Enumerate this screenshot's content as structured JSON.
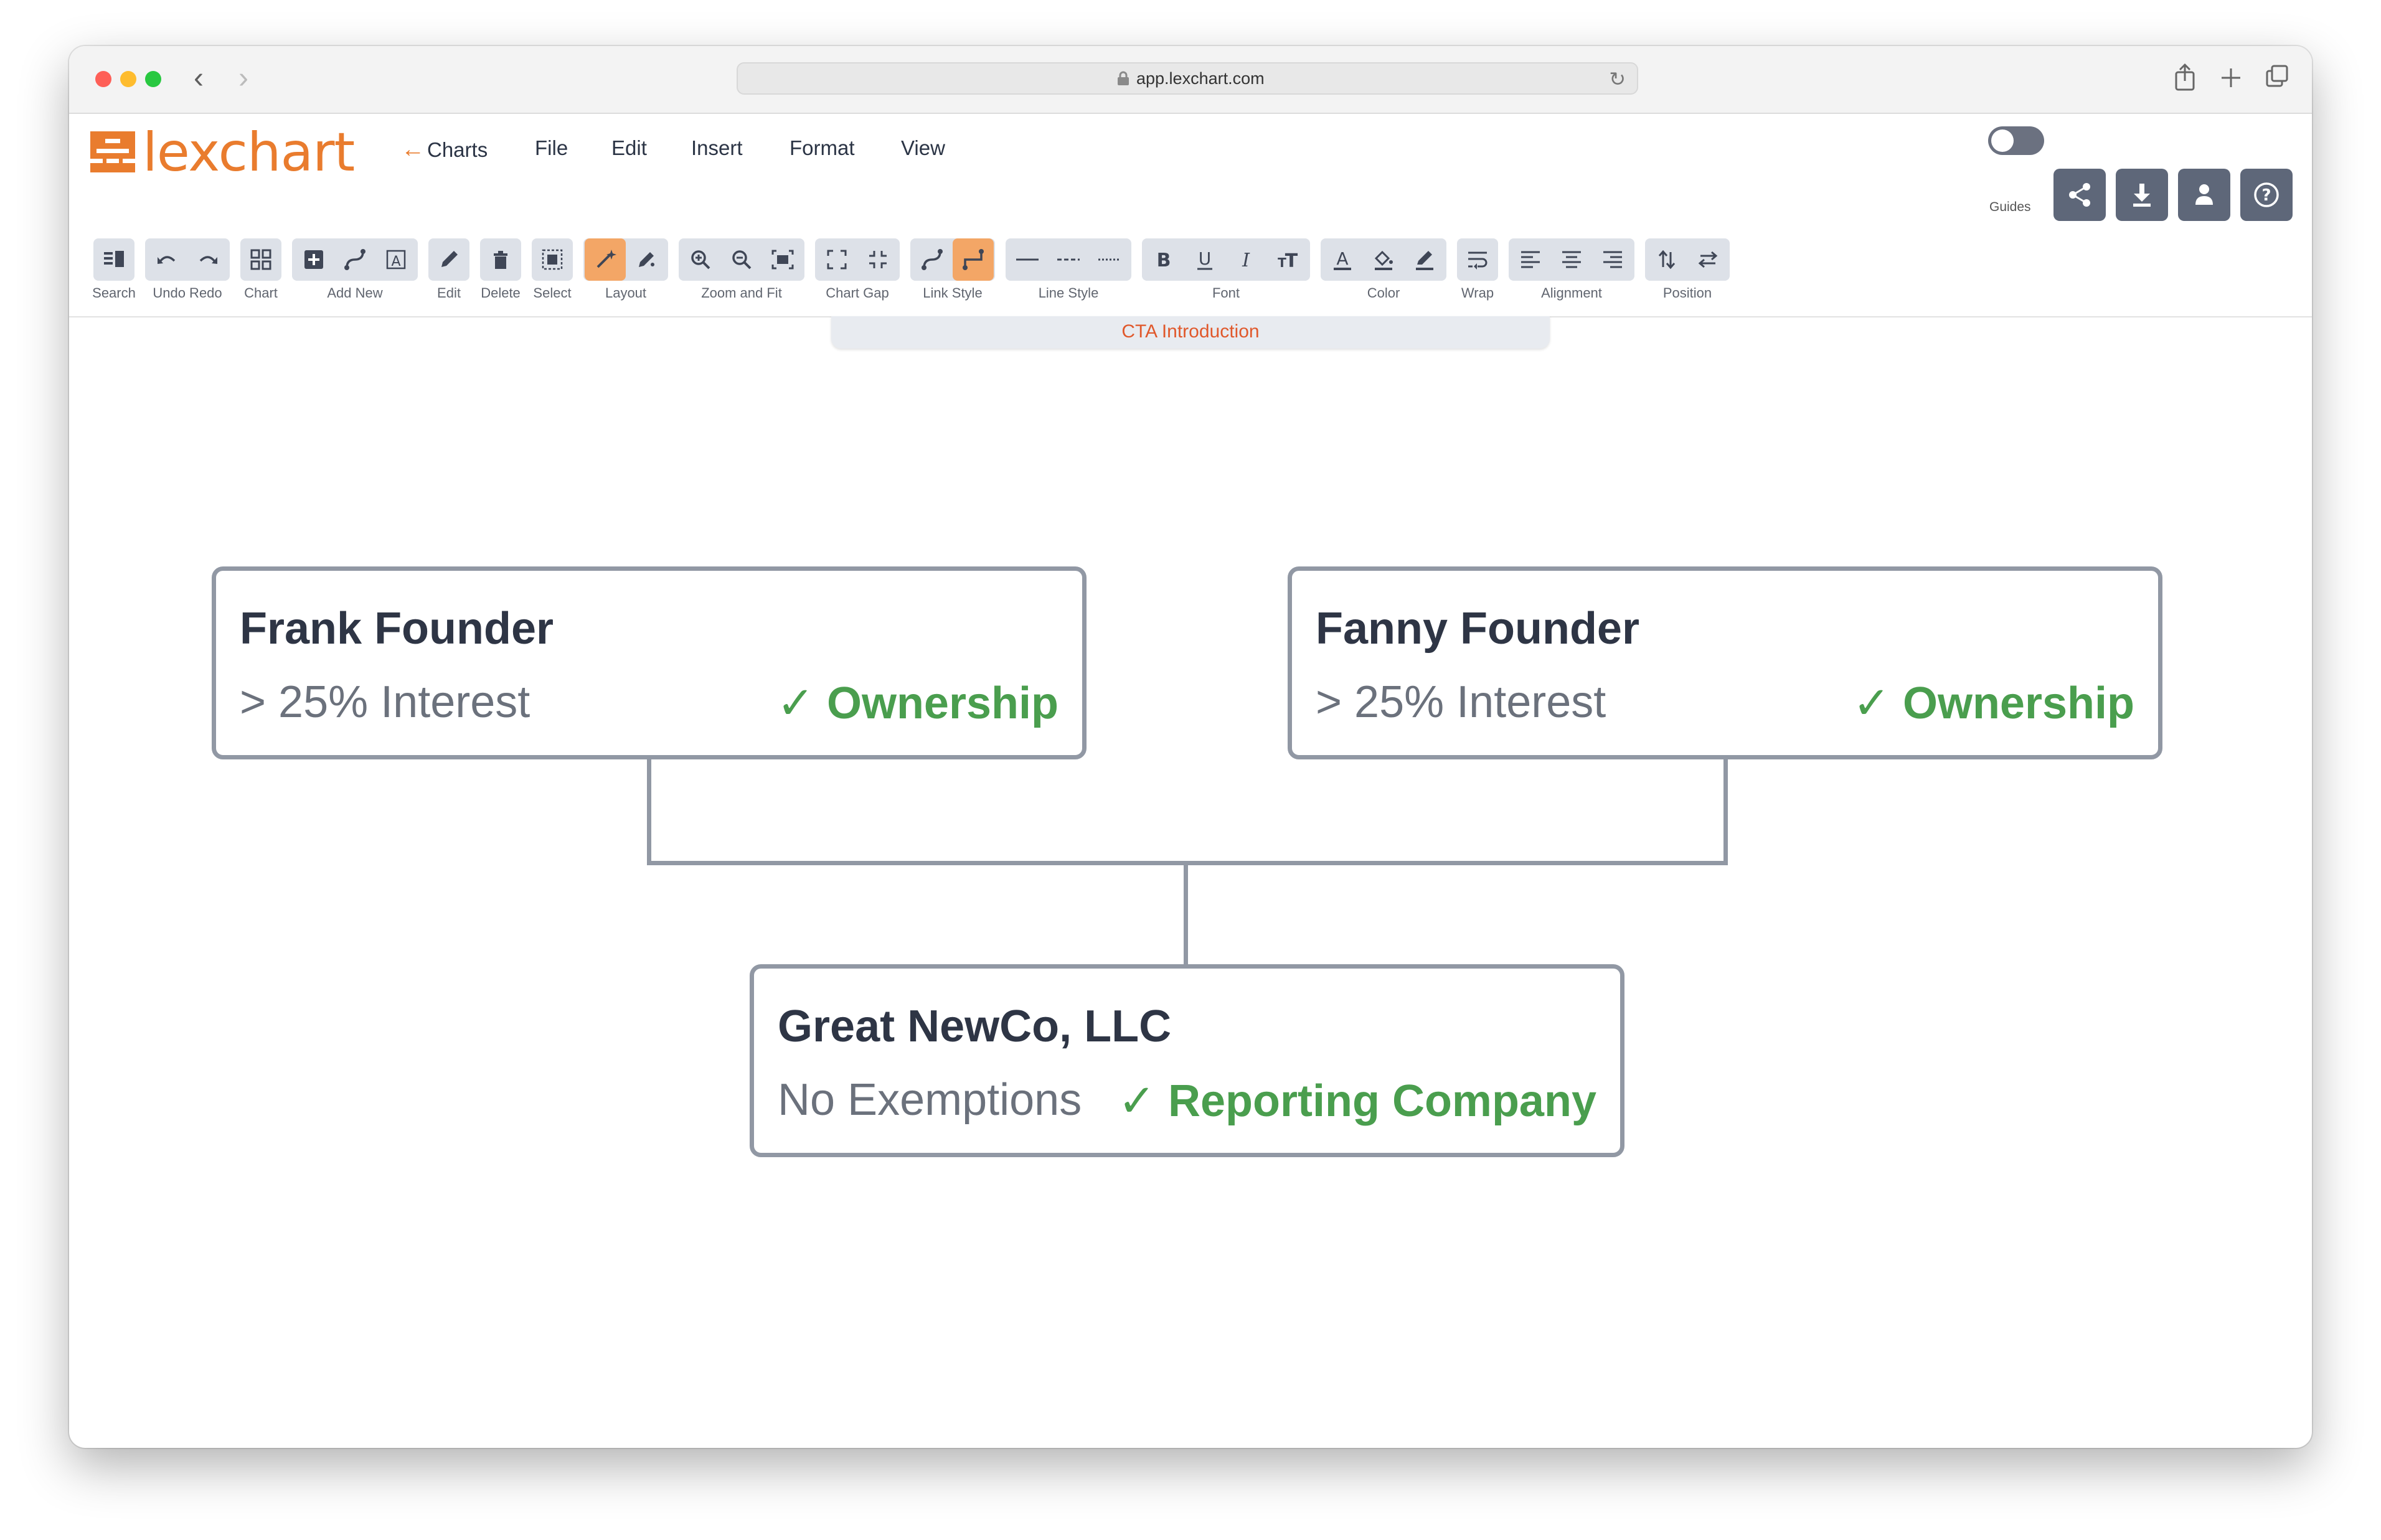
{
  "browser": {
    "url": "app.lexchart.com"
  },
  "app": {
    "logo_text": "lexchart",
    "colors": {
      "brand": "#e97c2e",
      "header_button": "#5e6779",
      "node_border": "#9198a4",
      "tag_green": "#4a9e4e"
    },
    "menu": {
      "back_label": "Charts",
      "items": [
        "File",
        "Edit",
        "Insert",
        "Format",
        "View"
      ]
    },
    "guides_label": "Guides",
    "header_buttons": [
      "share-icon",
      "download-icon",
      "user-icon",
      "help-icon"
    ],
    "toolbar": {
      "labels": {
        "search": "Search",
        "undo_redo": "Undo Redo",
        "chart": "Chart",
        "add_new": "Add New",
        "edit": "Edit",
        "delete": "Delete",
        "select": "Select",
        "layout": "Layout",
        "zoom": "Zoom and Fit",
        "chart_gap": "Chart Gap",
        "link_style": "Link Style",
        "line_style": "Line Style",
        "font": "Font",
        "color": "Color",
        "wrap": "Wrap",
        "alignment": "Alignment",
        "position": "Position"
      }
    },
    "tab": {
      "title": "CTA Introduction"
    }
  },
  "chart": {
    "nodes": [
      {
        "title": "Frank Founder",
        "subtitle": "> 25% Interest",
        "tag": "✓ Ownership"
      },
      {
        "title": "Fanny Founder",
        "subtitle": "> 25% Interest",
        "tag": "✓ Ownership"
      },
      {
        "title": "Great NewCo, LLC",
        "subtitle": "No Exemptions",
        "tag": "✓ Reporting Company"
      }
    ]
  }
}
